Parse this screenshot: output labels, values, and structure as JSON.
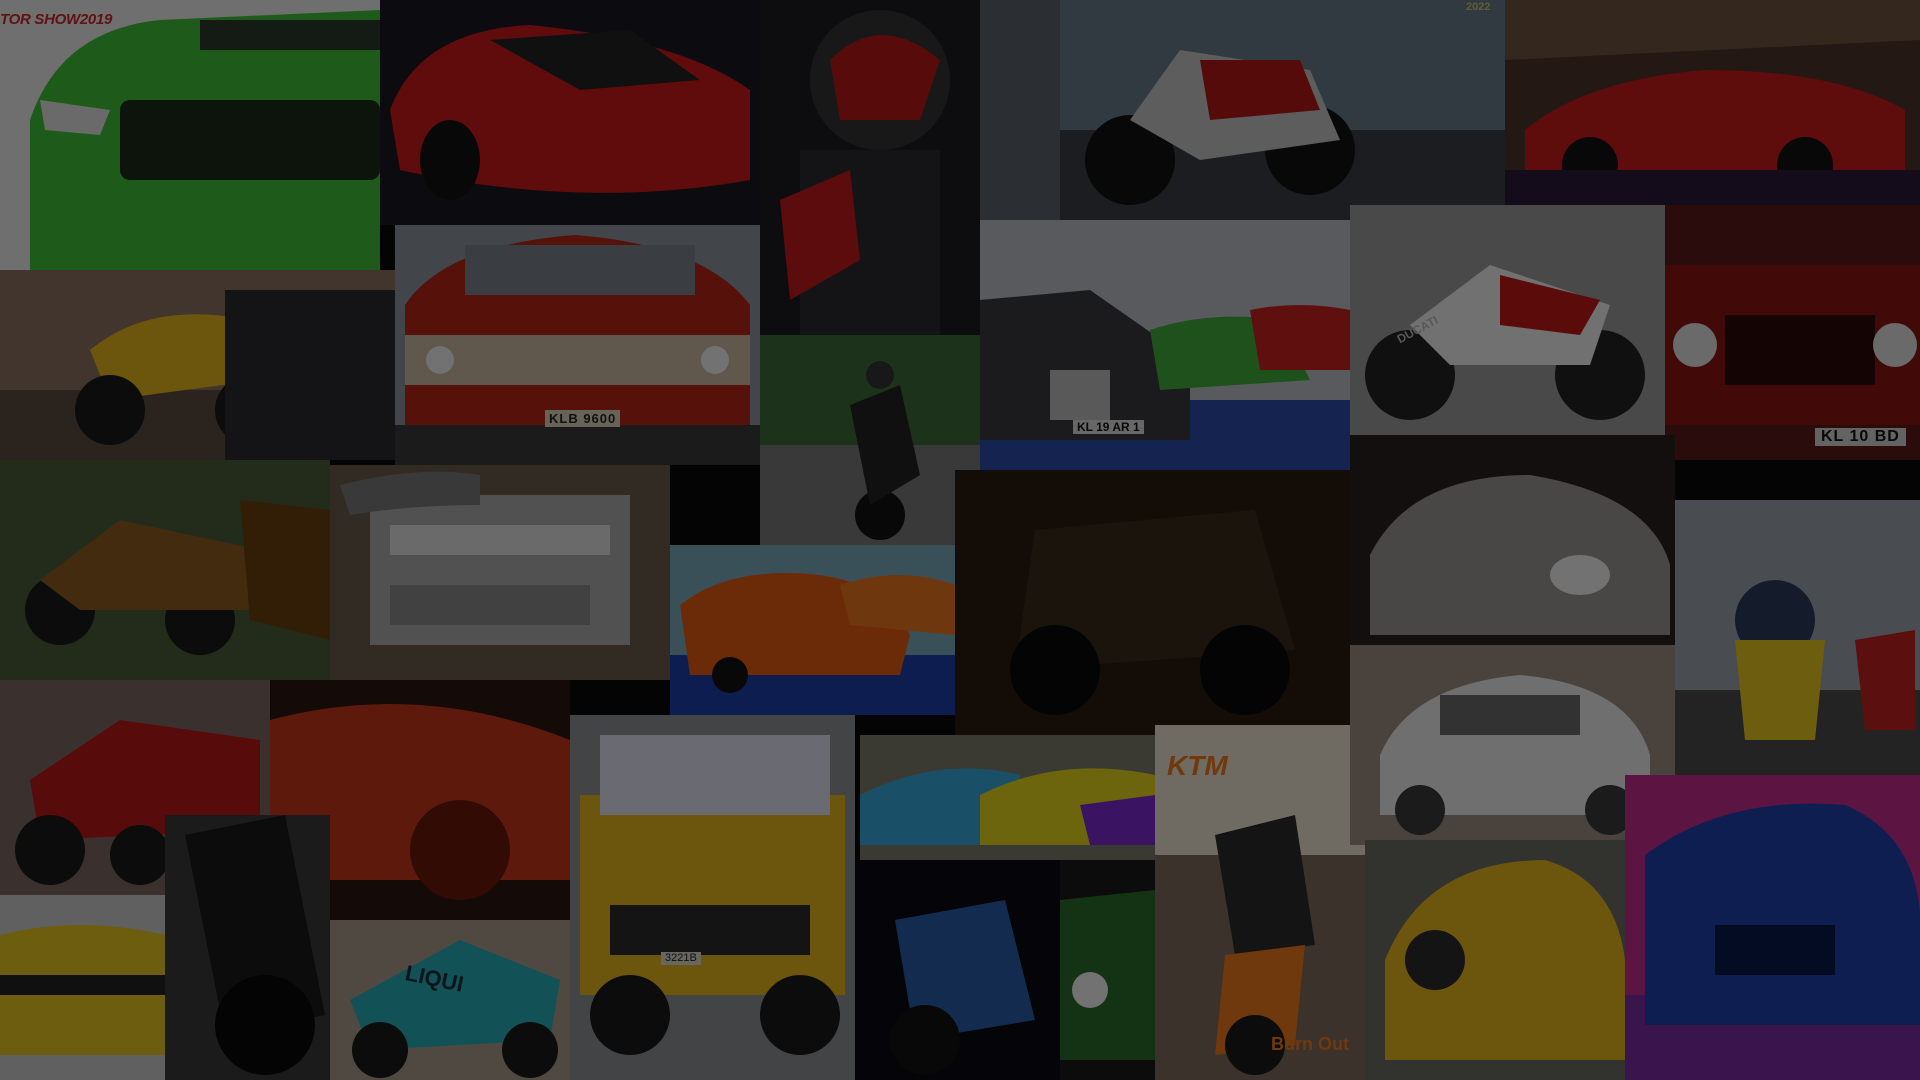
{
  "captions": {
    "motor_show_logo": "TOR SHOW2019",
    "year_2022": "2022",
    "plate_chevrolet": "KLB 9600",
    "plate_rolls": "KL 19 AR 1",
    "plate_mercedes": "KL 10 BD",
    "ducati_label": "DUCATI",
    "ktm_logo": "KTM",
    "burn_out": "Burn Out",
    "liqui_moly": "LIQUI",
    "plate_fj": "3221B"
  },
  "palette": {
    "overlay": "#000000",
    "mustang_green": "#3fbf3a",
    "lambo_red": "#c91a1a",
    "ducati_red": "#b01616",
    "yellow": "#e2b41e",
    "orange_mustang": "#e05a14",
    "blue_bmw": "#1e3fa8",
    "teal": "#26a9b4",
    "white_swift": "#e8e8e8"
  },
  "tiles": [
    {
      "name": "green-mustang",
      "icon": "car-icon"
    },
    {
      "name": "red-lamborghini",
      "icon": "car-icon"
    },
    {
      "name": "rider-helmet",
      "icon": "helmet-icon"
    },
    {
      "name": "ducati-showroom",
      "icon": "motorcycle-icon"
    },
    {
      "name": "red-huracan",
      "icon": "car-icon"
    },
    {
      "name": "yellow-hayabusa",
      "icon": "motorcycle-icon"
    },
    {
      "name": "red-chevrolet",
      "icon": "car-icon"
    },
    {
      "name": "stunt-wheelie",
      "icon": "motorcycle-icon"
    },
    {
      "name": "rolls-royce-lineup",
      "icon": "car-icon"
    },
    {
      "name": "ducati-panigale",
      "icon": "motorcycle-icon"
    },
    {
      "name": "mercedes-g-wagon",
      "icon": "car-icon"
    },
    {
      "name": "bike-group",
      "icon": "motorcycle-icon"
    },
    {
      "name": "engine-bay",
      "icon": "engine-icon"
    },
    {
      "name": "orange-mustang",
      "icon": "car-icon"
    },
    {
      "name": "offroad-jeep",
      "icon": "car-icon"
    },
    {
      "name": "white-beetle",
      "icon": "car-icon"
    },
    {
      "name": "street-riders",
      "icon": "motorcycle-icon"
    },
    {
      "name": "red-sportbikes",
      "icon": "motorcycle-icon"
    },
    {
      "name": "red-car-close",
      "icon": "car-icon"
    },
    {
      "name": "yellow-fj-cruiser",
      "icon": "car-icon"
    },
    {
      "name": "colorful-cars",
      "icon": "car-icon"
    },
    {
      "name": "ktm-stunt",
      "icon": "motorcycle-icon"
    },
    {
      "name": "white-swift",
      "icon": "car-icon"
    },
    {
      "name": "yellow-camaro",
      "icon": "car-icon"
    },
    {
      "name": "black-bike",
      "icon": "motorcycle-icon"
    },
    {
      "name": "teal-sportbike",
      "icon": "motorcycle-icon"
    },
    {
      "name": "night-bike",
      "icon": "motorcycle-icon"
    },
    {
      "name": "green-challenger",
      "icon": "car-icon"
    },
    {
      "name": "yellow-porsche",
      "icon": "car-icon"
    },
    {
      "name": "blue-bmw",
      "icon": "car-icon"
    }
  ]
}
